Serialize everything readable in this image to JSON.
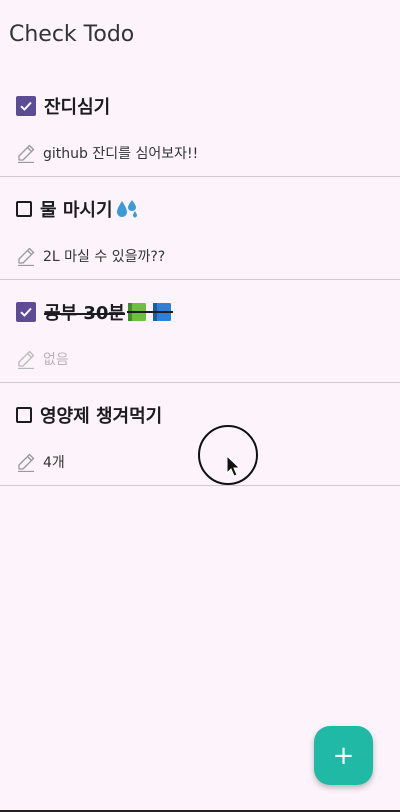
{
  "app": {
    "title": "Check Todo"
  },
  "todos": [
    {
      "title": "잔디심기",
      "emoji": "",
      "memo": "github 잔디를 심어보자!!",
      "checked": true,
      "memo_empty": false
    },
    {
      "title": "물 마시기",
      "emoji": "sweat-droplets-emoji",
      "memo": "2L 마실 수 있을까??",
      "checked": false,
      "memo_empty": false
    },
    {
      "title": "공부 30분",
      "emoji": "books-emoji",
      "memo": "없음",
      "checked": true,
      "memo_empty": true
    },
    {
      "title": "영양제 챙겨먹기",
      "emoji": "",
      "memo": "4개",
      "checked": false,
      "memo_empty": false
    }
  ],
  "fab": {
    "icon": "plus-icon",
    "label": "+"
  },
  "colors": {
    "background": "#fcf4fa",
    "checkbox_checked": "#5e4b96",
    "fab": "#1fb9a6",
    "divider": "#cfc9cf"
  }
}
